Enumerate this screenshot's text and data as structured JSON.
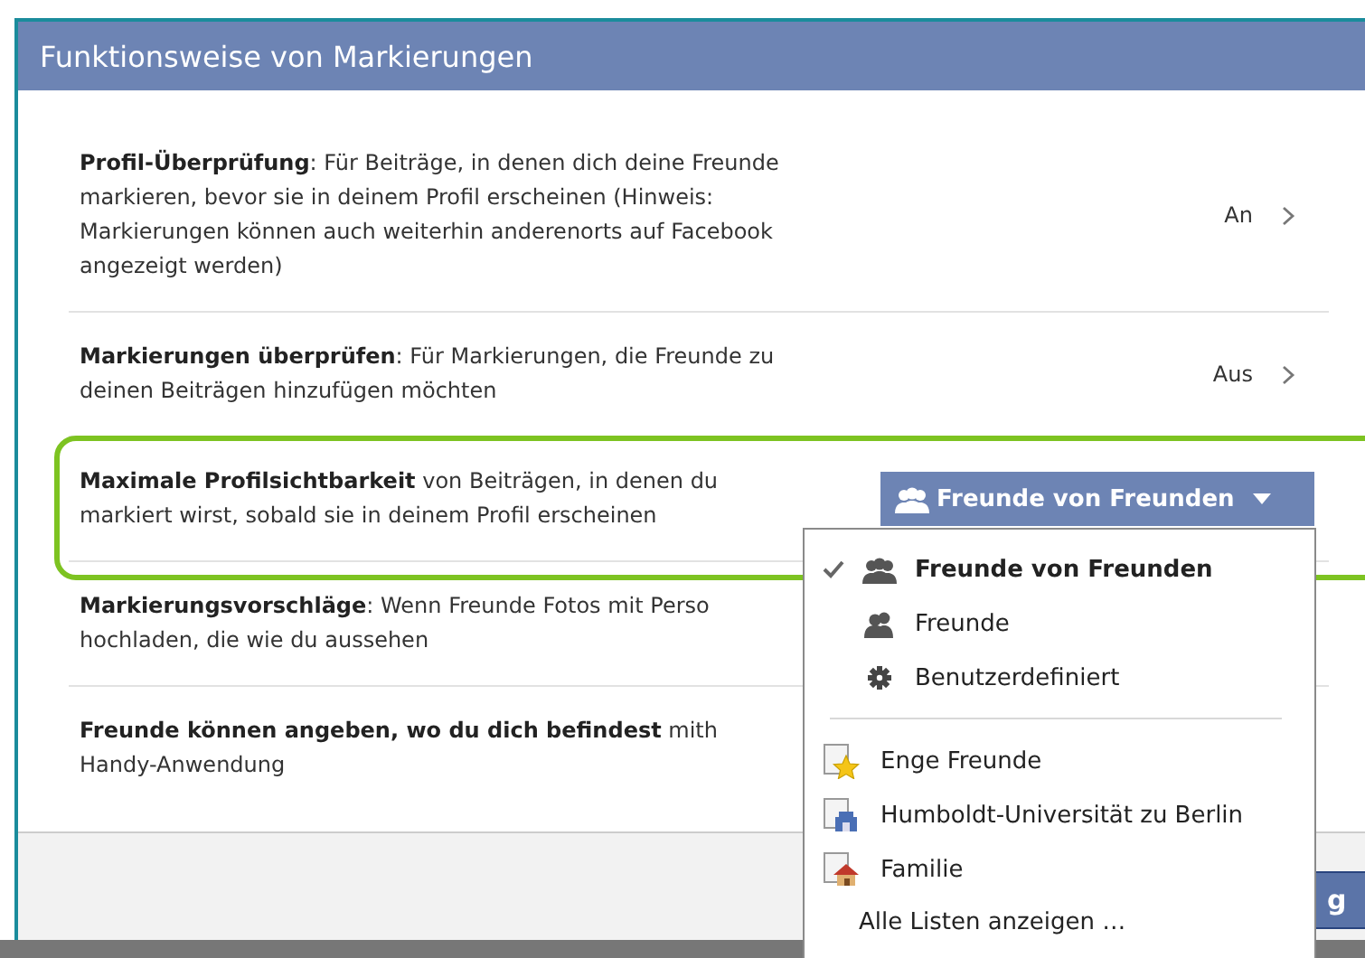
{
  "dialog": {
    "title": "Funktionsweise von Markierungen"
  },
  "rows": [
    {
      "kind": "toggle",
      "text": "**Profil-Überprüfung**: Für Beiträge, in denen dich deine Freunde\nmarkieren, bevor sie in deinem Profil erscheinen (Hinweis:\nMarkierungen können auch weiterhin anderenorts auf Facebook\nangezeigt werden)",
      "value": "An"
    },
    {
      "kind": "toggle",
      "text": "**Markierungen überprüfen**: Für Markierungen, die Freunde zu\ndeinen Beiträgen hinzufügen möchten",
      "value": "Aus"
    },
    {
      "kind": "dropdown",
      "text": "**Maximale Profilsichtbarkeit** von Beiträgen, in denen du\nmarkiert wirst, sobald sie in deinem Profil erscheinen",
      "value": "Freunde von Freunden"
    },
    {
      "kind": "covered",
      "text": "**Markierungsvorschläge**: Wenn Freunde Fotos mit Perso\nhochladen, die wie du aussehen"
    },
    {
      "kind": "covered",
      "text": "**Freunde können angeben, wo du dich befindest** mith\nHandy-Anwendung"
    }
  ],
  "menu": {
    "sections": [
      [
        {
          "label": "Freunde von Freunden",
          "selected": true,
          "kind": "group"
        },
        {
          "label": "Freunde",
          "selected": false,
          "kind": "friends"
        },
        {
          "label": "Benutzerdefiniert",
          "selected": false,
          "kind": "custom"
        }
      ],
      [
        {
          "label": "Enge Freunde",
          "selected": false,
          "kind": "favorites"
        },
        {
          "label": "Humboldt-Universität zu Berlin",
          "selected": false,
          "kind": "school"
        },
        {
          "label": "Familie",
          "selected": false,
          "kind": "family"
        }
      ]
    ],
    "link": "Alle Listen anzeigen …"
  },
  "footer": {
    "button": "g"
  }
}
